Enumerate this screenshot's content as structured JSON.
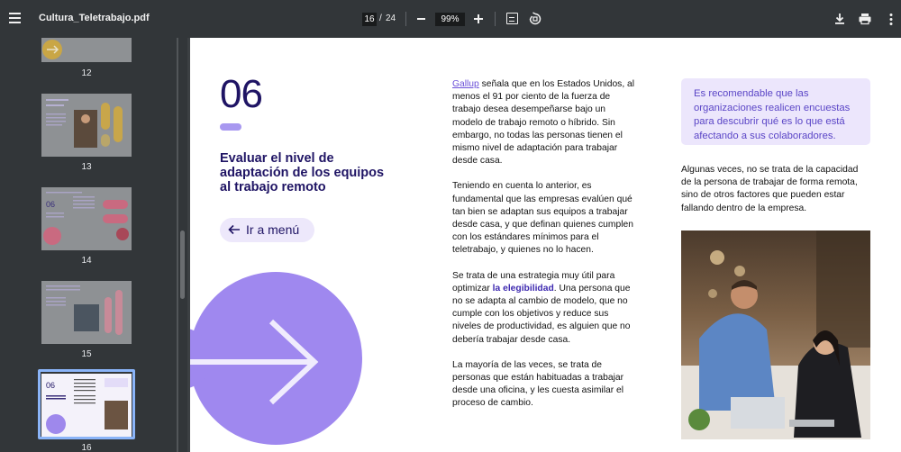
{
  "toolbar": {
    "title": "Cultura_Teletrabajo.pdf",
    "current_page": "16",
    "page_separator": "/",
    "total_pages": "24",
    "zoom": "99%"
  },
  "sidebar": {
    "thumbnails": [
      {
        "label": "12"
      },
      {
        "label": "13"
      },
      {
        "label": "14"
      },
      {
        "label": "15"
      },
      {
        "label": "16",
        "selected": true
      }
    ]
  },
  "page": {
    "number": "06",
    "title": "Evaluar el nivel de adaptación de los equipos al trabajo remoto",
    "menu_button": "Ir a menú",
    "col1": {
      "p1_link": "Gallup",
      "p1_rest": " señala que en los Estados Unidos, al menos el 91 por ciento de la fuerza de trabajo desea desempeñarse bajo un modelo de trabajo remoto o híbrido. Sin embargo, no todas las personas tienen el mismo nivel de adaptación para trabajar desde casa.",
      "p2": "Teniendo en cuenta lo anterior, es fundamental que las empresas evalúen qué tan bien se adaptan sus equipos a trabajar desde casa, y que definan quienes cumplen con los estándares mínimos para el teletrabajo, y quienes no lo hacen.",
      "p3_a": "Se trata de una estrategia muy útil para optimizar ",
      "p3_link": "la elegibilidad",
      "p3_b": ". Una persona que no se adapta al cambio de modelo, que no cumple con los objetivos y reduce sus niveles de productividad, es alguien que no debería trabajar desde casa.",
      "p4": "La mayoría de las veces, se trata de personas que están habituadas a trabajar desde una oficina, y les cuesta asimilar el proceso de cambio."
    },
    "quote": "Es recomendable que las organizaciones realicen encuestas para descubrir qué es lo que está afectando a sus colaboradores.",
    "col2_p1": "Algunas veces, no se trata de la capacidad de la persona de trabajar de forma remota, sino de otros factores que pueden estar fallando dentro de la empresa."
  },
  "colors": {
    "navy": "#1f1464",
    "purple": "#a898f0",
    "lavender": "#ede8fb",
    "link": "#6a4fd8"
  }
}
